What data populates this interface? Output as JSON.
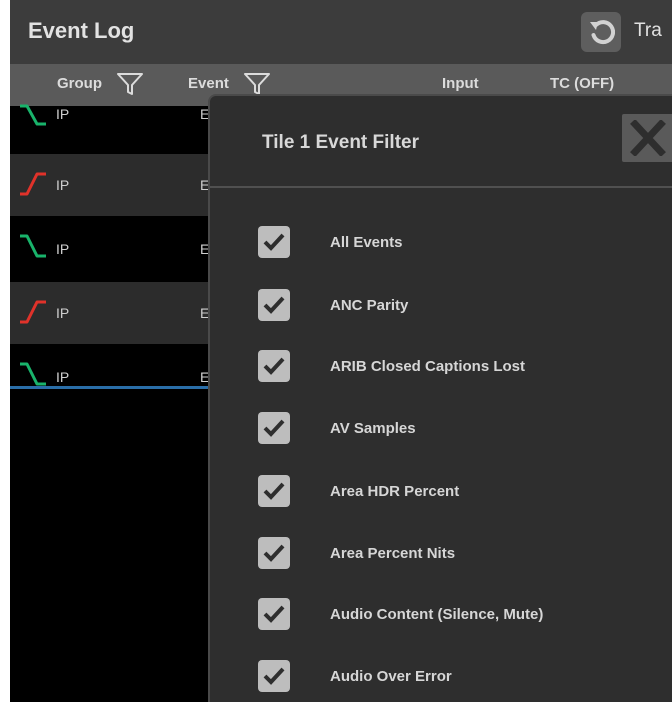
{
  "app": {
    "title": "Event Log",
    "trace_label": "Tra",
    "columns": {
      "group": "Group",
      "event": "Event",
      "input": "Input",
      "tc": "TC (OFF)"
    },
    "rows": [
      {
        "group": "IP",
        "event": "E",
        "edge": "falling",
        "edge_color": "#19b36b"
      },
      {
        "group": "IP",
        "event": "E",
        "edge": "rising",
        "edge_color": "#e0322a"
      },
      {
        "group": "IP",
        "event": "E",
        "edge": "falling",
        "edge_color": "#19b36b"
      },
      {
        "group": "IP",
        "event": "E",
        "edge": "rising",
        "edge_color": "#e0322a"
      },
      {
        "group": "IP",
        "event": "E",
        "edge": "falling",
        "edge_color": "#19b36b"
      }
    ]
  },
  "dialog": {
    "title": "Tile 1 Event Filter",
    "close_label": "X",
    "items": [
      {
        "label": "All Events",
        "checked": true
      },
      {
        "label": "ANC Parity",
        "checked": true
      },
      {
        "label": "ARIB Closed Captions Lost",
        "checked": true
      },
      {
        "label": "AV Samples",
        "checked": true
      },
      {
        "label": "Area HDR Percent",
        "checked": true
      },
      {
        "label": "Area Percent Nits",
        "checked": true
      },
      {
        "label": "Audio Content (Silence, Mute)",
        "checked": true
      },
      {
        "label": "Audio Over Error",
        "checked": true
      }
    ]
  }
}
